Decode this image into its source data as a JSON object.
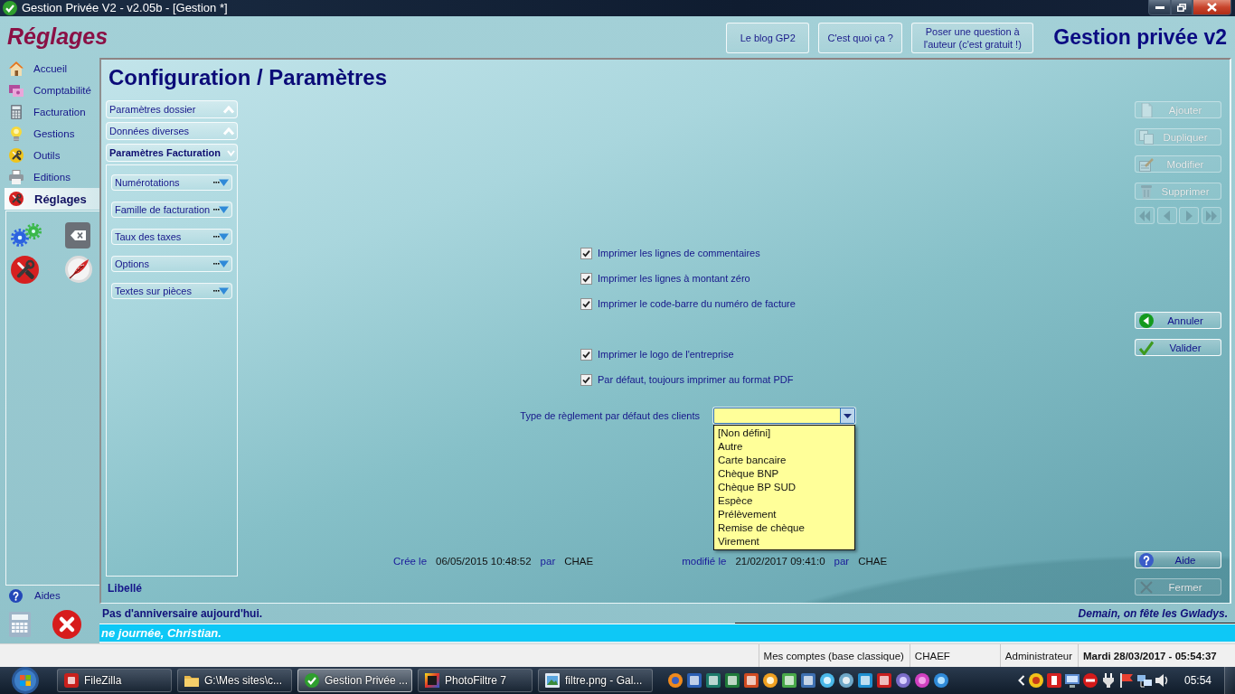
{
  "window": {
    "title": "Gestion Privée V2 - v2.05b - [Gestion *]"
  },
  "header": {
    "section_title": "Réglages",
    "links": [
      {
        "label": "Le blog GP2"
      },
      {
        "label": "C'est quoi ça ?"
      },
      {
        "label": "Poser une question à l'auteur (c'est gratuit !)"
      }
    ],
    "app_title": "Gestion privée v2"
  },
  "sidebar": {
    "items": [
      {
        "label": "Accueil",
        "selected": false
      },
      {
        "label": "Comptabilité",
        "selected": false
      },
      {
        "label": "Facturation",
        "selected": false
      },
      {
        "label": "Gestions",
        "selected": false
      },
      {
        "label": "Outils",
        "selected": false
      },
      {
        "label": "Editions",
        "selected": false
      },
      {
        "label": "Réglages",
        "selected": true
      }
    ],
    "help": "Aides"
  },
  "page": {
    "title": "Configuration / Paramètres"
  },
  "accordion": {
    "sections": [
      {
        "label": "Paramètres dossier",
        "expanded": false
      },
      {
        "label": "Données diverses",
        "expanded": false
      },
      {
        "label": "Paramètres Facturation",
        "expanded": true,
        "children": [
          {
            "label": "Numérotations"
          },
          {
            "label": "Famille de facturation"
          },
          {
            "label": "Taux des taxes"
          },
          {
            "label": "Options"
          },
          {
            "label": "Textes sur pièces"
          }
        ]
      }
    ],
    "footer": "Libellé"
  },
  "option_groups": [
    {
      "items": [
        {
          "label": "Imprimer les lignes de commentaires",
          "checked": true
        },
        {
          "label": "Imprimer les lignes à montant zéro",
          "checked": true
        },
        {
          "label": "Imprimer le code-barre du numéro de facture",
          "checked": true
        }
      ]
    },
    {
      "items": [
        {
          "label": "Imprimer le logo de l'entreprise",
          "checked": true
        },
        {
          "label": "Par défaut, toujours imprimer au format PDF",
          "checked": true
        }
      ]
    }
  ],
  "payment_type": {
    "label": "Type de règlement par défaut des clients",
    "expanded": true,
    "options": [
      {
        "label": "[Non défini]",
        "selected": false
      },
      {
        "label": "Autre",
        "selected": false
      },
      {
        "label": "Carte bancaire",
        "selected": false
      },
      {
        "label": "Chèque BNP",
        "selected": false
      },
      {
        "label": "Chèque BP SUD",
        "selected": false
      },
      {
        "label": "Espèce",
        "selected": false
      },
      {
        "label": "Prélèvement",
        "selected": false
      },
      {
        "label": "Remise de chèque",
        "selected": false
      },
      {
        "label": "Virement",
        "selected": false
      }
    ]
  },
  "record": {
    "created": {
      "label": "Crée le",
      "date": "06/05/2015 10:48:52",
      "by_label": "par",
      "by": "CHAE"
    },
    "modified": {
      "label": "modifié le",
      "date": "21/02/2017 09:41:0",
      "by_label": "par",
      "by": "CHAE"
    }
  },
  "actions": [
    {
      "label": "Ajouter",
      "disabled": true
    },
    {
      "label": "Dupliquer",
      "disabled": true
    },
    {
      "label": "Modifier",
      "disabled": true
    },
    {
      "label": "Supprimer",
      "disabled": true
    }
  ],
  "record_navigation": [
    {
      "disabled": true
    },
    {
      "disabled": true
    },
    {
      "disabled": true
    },
    {
      "disabled": true
    }
  ],
  "confirm_buttons": [
    {
      "label": "Annuler",
      "disabled": false
    },
    {
      "label": "Valider",
      "disabled": false
    }
  ],
  "footer_buttons": [
    {
      "label": "Aide",
      "disabled": false
    },
    {
      "label": "Fermer",
      "disabled": true
    }
  ],
  "messages": {
    "birthday": "Pas d'anniversaire aujourd'hui.",
    "name_day": "Demain, on fête les Gwladys.",
    "ticker": "ne journée, Christian."
  },
  "status_bar": [
    {
      "text": "Mes comptes (base classique)"
    },
    {
      "text": "CHAEF"
    },
    {
      "text": "Administrateur"
    },
    {
      "text": "Mardi 28/03/2017 - 05:54:37"
    }
  ],
  "taskbar": {
    "tasks": [
      {
        "label": "FileZilla",
        "selected": false
      },
      {
        "label": "G:\\Mes sites\\c...",
        "selected": false
      },
      {
        "label": "Gestion Privée ...",
        "selected": true
      },
      {
        "label": "PhotoFiltre 7",
        "selected": false
      },
      {
        "label": "filtre.png - Gal...",
        "selected": false
      }
    ],
    "clock": "05:54"
  }
}
